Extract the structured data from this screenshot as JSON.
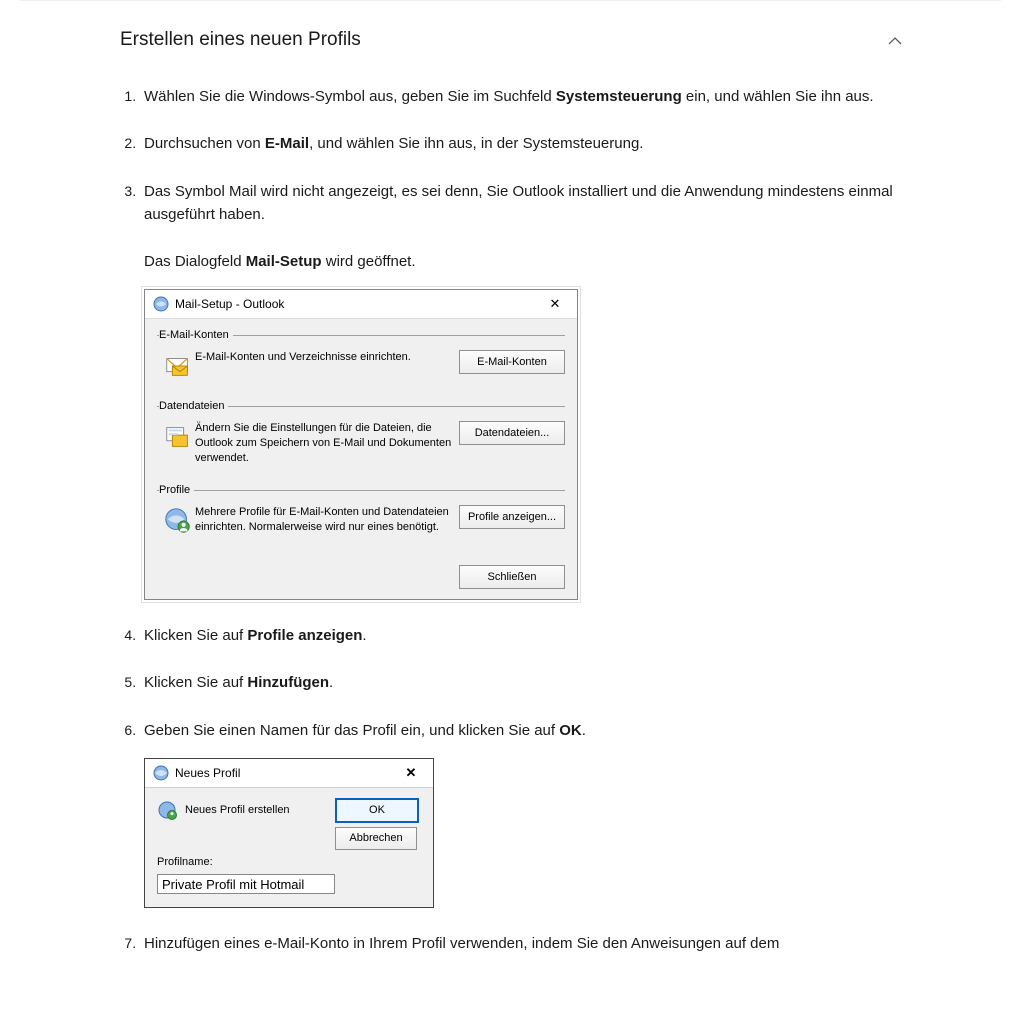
{
  "heading": "Erstellen eines neuen Profils",
  "steps": {
    "1": {
      "pre": "Wählen Sie die Windows-Symbol aus, geben Sie im Suchfeld ",
      "bold": "Systemsteuerung",
      "post": " ein, und wählen Sie ihn aus."
    },
    "2": {
      "pre": "Durchsuchen von ",
      "bold": "E-Mail",
      "post": ", und wählen Sie ihn aus, in der Systemsteuerung."
    },
    "3": {
      "line1": "Das Symbol Mail wird nicht angezeigt, es sei denn, Sie Outlook installiert und die Anwendung mindestens einmal ausgeführt haben.",
      "sub_pre": "Das Dialogfeld ",
      "sub_bold": "Mail-Setup",
      "sub_post": " wird geöffnet."
    },
    "4": {
      "pre": "Klicken Sie auf ",
      "bold": "Profile anzeigen",
      "post": "."
    },
    "5": {
      "pre": "Klicken Sie auf ",
      "bold": "Hinzufügen",
      "post": "."
    },
    "6": {
      "pre": "Geben Sie einen Namen für das Profil ein, und klicken Sie auf ",
      "bold": "OK",
      "post": "."
    },
    "7": {
      "line": "Hinzufügen eines e-Mail-Konto in Ihrem Profil verwenden, indem Sie den Anweisungen auf dem"
    }
  },
  "mail_setup": {
    "title": "Mail-Setup - Outlook",
    "sections": {
      "accounts": {
        "legend": "E-Mail-Konten",
        "text": "E-Mail-Konten und Verzeichnisse einrichten.",
        "button": "E-Mail-Konten"
      },
      "datafiles": {
        "legend": "Datendateien",
        "text": "Ändern Sie die Einstellungen für die Dateien, die Outlook zum Speichern von E-Mail und Dokumenten verwendet.",
        "button": "Datendateien..."
      },
      "profiles": {
        "legend": "Profile",
        "text": "Mehrere Profile für E-Mail-Konten und Datendateien einrichten. Normalerweise wird nur eines benötigt.",
        "button": "Profile anzeigen..."
      }
    },
    "close_button": "Schließen"
  },
  "new_profile": {
    "title": "Neues Profil",
    "create_label": "Neues Profil erstellen",
    "ok": "OK",
    "cancel": "Abbrechen",
    "name_label": "Profilname:",
    "name_value": "Private Profil mit Hotmail"
  }
}
